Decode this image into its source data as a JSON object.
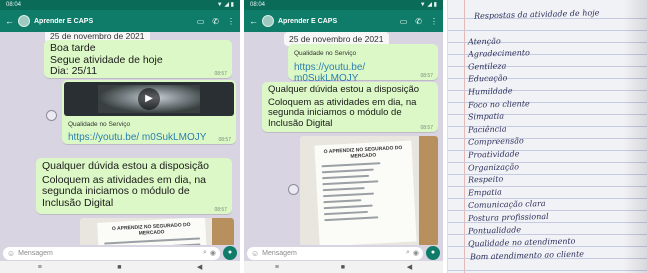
{
  "phone1": {
    "status_time": "08:04",
    "status_right": "▼ ◢ ▮",
    "group_name": "Aprender É CAPS",
    "date_chip": "25 de novembro de 2021",
    "greeting_lines": [
      "Boa tarde",
      "Segue atividade de hoje",
      "Dia: 25/11"
    ],
    "greeting_time": "08:57",
    "video_caption": "Qualidade no Serviço",
    "video_link": "https://youtu.be/ m0SukLMOJY",
    "video_time": "08:57",
    "msg1": "Qualquer dúvida estou a disposição",
    "msg2": "Coloquem as atividades em dia, na segunda iniciamos o módulo de Inclusão Digital",
    "msg_time": "08:57",
    "doc_title": "O APRENDIZ NO SEGURADO DO MERCADO"
  },
  "phone2": {
    "status_time": "08:04",
    "status_right": "▼ ◢ ▮",
    "group_name": "Aprender É CAPS",
    "date_chip": "25 de novembro de 2021",
    "top_caption": "Qualidade no Serviço",
    "top_link": "https://youtu.be/ m0SukLMOJY",
    "top_time": "08:57",
    "msg1": "Qualquer dúvida estou a disposição",
    "msg2": "Coloquem as atividades em dia, na segunda iniciamos o módulo de Inclusão Digital",
    "msg_time": "08:57",
    "doc_title": "O APRENDIZ NO SEGURADO DO MERCADO"
  },
  "composer": {
    "placeholder": "Mensagem",
    "emoji_icon": "☺",
    "clip_icon": "⌕",
    "camera_icon": "◉",
    "mic_icon": "●"
  },
  "navbar": {
    "recents": "≡",
    "home": "■",
    "back": "◀"
  },
  "appbar_icons": {
    "back": "←",
    "video": "▭",
    "call": "✆",
    "menu": "⋮"
  },
  "notebook": {
    "lines": [
      "Respostas da atividade de hoje",
      "Atenção",
      "Agradecimento",
      "Gentileza",
      "Educação",
      "Humildade",
      "Foco no cliente",
      "Simpatia",
      "Paciência",
      "Compreensão",
      "Proatividade",
      "Organização",
      "Respeito",
      "Empatia",
      "Comunicação clara",
      "Postura profissional",
      "Pontualidade",
      "Qualidade no atendimento",
      "Bom atendimento ao cliente"
    ]
  }
}
